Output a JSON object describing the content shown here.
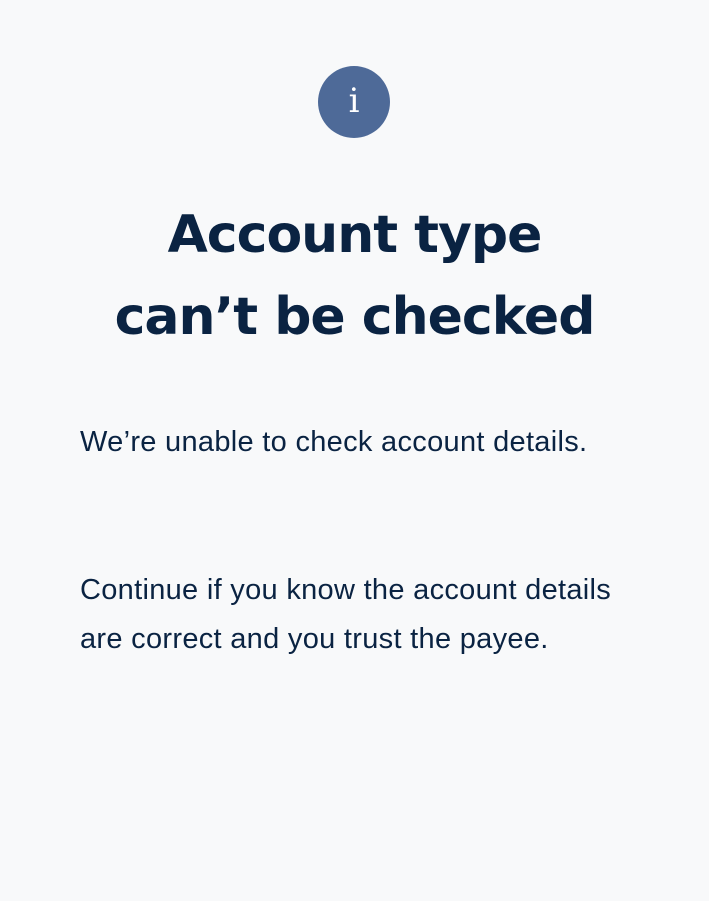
{
  "icon": {
    "name": "info-icon",
    "glyph": "i",
    "color": "#4e6a98"
  },
  "title": {
    "line1": "Account type",
    "line2": "can’t be checked"
  },
  "message": {
    "paragraph1": "We’re unable to check account details.",
    "paragraph2": "Continue if you know the account details are correct and you trust the payee."
  },
  "colors": {
    "background": "#f8f9fa",
    "text": "#0a2342"
  }
}
